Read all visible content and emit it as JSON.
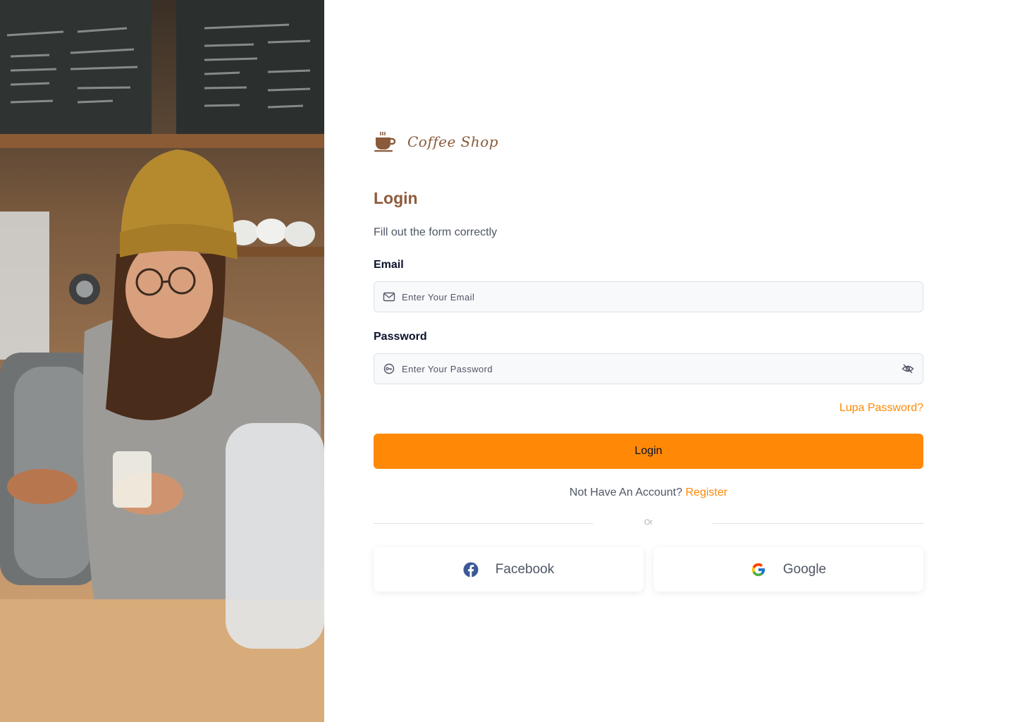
{
  "brand": {
    "name": "Coffee Shop",
    "icon": "coffee-cup-icon",
    "color": "#8a5a3b"
  },
  "form": {
    "title": "Login",
    "subtitle": "Fill out the form correctly",
    "email": {
      "label": "Email",
      "placeholder": "Enter Your Email",
      "icon": "mail-icon"
    },
    "password": {
      "label": "Password",
      "placeholder": "Enter Your Password",
      "icon": "key-icon",
      "toggle_icon": "eye-off-icon"
    },
    "forgot_label": "Lupa Password?",
    "submit_label": "Login",
    "no_account_text": "Not Have An Account?",
    "register_label": "Register",
    "or_text": "Or"
  },
  "social": [
    {
      "label": "Facebook",
      "icon": "facebook-icon"
    },
    {
      "label": "Google",
      "icon": "google-icon"
    }
  ],
  "colors": {
    "accent": "#ff8906",
    "title_brown": "#8e5a3c",
    "text_muted": "#4f5665",
    "text_dark": "#0b132a"
  }
}
